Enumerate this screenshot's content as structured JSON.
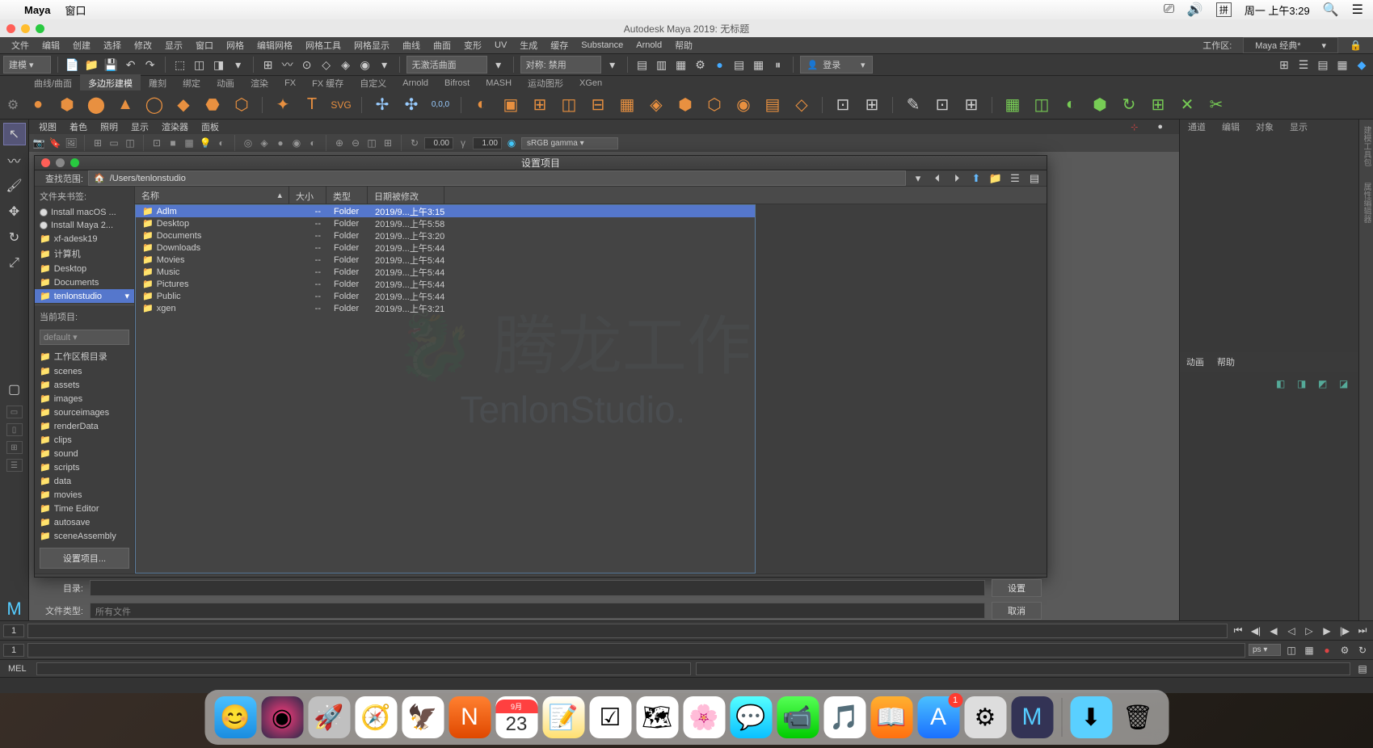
{
  "mac": {
    "app": "Maya",
    "menu": [
      "窗口"
    ],
    "tray": {
      "ime": "拼",
      "clock": "周一 上午3:29"
    }
  },
  "maya": {
    "title": "Autodesk Maya 2019: 无标题",
    "main_menu": [
      "文件",
      "编辑",
      "创建",
      "选择",
      "修改",
      "显示",
      "窗口",
      "网格",
      "编辑网格",
      "网格工具",
      "网格显示",
      "曲线",
      "曲面",
      "变形",
      "UV",
      "生成",
      "缓存",
      "Arnold",
      "帮助"
    ],
    "workspace_label": "工作区:",
    "workspace": "Maya 经典*",
    "mode": "建模",
    "curve_select": "无激活曲面",
    "sym_label": "对称: 禁用",
    "login": "登录",
    "shelf_tabs": [
      "曲线/曲面",
      "多边形建模",
      "雕刻",
      "绑定",
      "动画",
      "渲染",
      "FX",
      "FX 缓存",
      "自定义",
      "Arnold",
      "Bifrost",
      "MASH",
      "运动图形",
      "XGen"
    ],
    "active_shelf": 1,
    "panel_menu": [
      "视图",
      "着色",
      "照明",
      "显示",
      "渲染器",
      "面板"
    ],
    "panel_vals": {
      "v1": "0.00",
      "v2": "1.00",
      "colorspace": "sRGB gamma"
    },
    "right_tabs": [
      "通道",
      "编辑",
      "对象",
      "显示"
    ],
    "anim_tabs": [
      "动画",
      "帮助"
    ],
    "time": {
      "start": "1",
      "start2": "1",
      "fps": "ps"
    },
    "mel": "MEL",
    "sub_tab": "Substance"
  },
  "dialog": {
    "title": "设置项目",
    "search_label": "查找范围:",
    "path": "/Users/tenlonstudio",
    "bookmarks_label": "文件夹书签:",
    "bookmarks": [
      {
        "t": "disk",
        "label": "Install macOS ..."
      },
      {
        "t": "disk",
        "label": "Install Maya 2..."
      },
      {
        "t": "fold",
        "label": "xf-adesk19"
      },
      {
        "t": "fold",
        "label": "计算机"
      },
      {
        "t": "fold",
        "label": "Desktop"
      },
      {
        "t": "fold",
        "label": "Documents"
      },
      {
        "t": "fold",
        "label": "tenlonstudio",
        "sel": true
      }
    ],
    "current_label": "当前项目:",
    "current_sel": "default",
    "proj_dirs": [
      "工作区根目录",
      "scenes",
      "assets",
      "images",
      "sourceimages",
      "renderData",
      "clips",
      "sound",
      "scripts",
      "data",
      "movies",
      "Time Editor",
      "autosave",
      "sceneAssembly"
    ],
    "set_btn": "设置项目...",
    "cols": {
      "name": "名称",
      "size": "大小",
      "type": "类型",
      "date": "日期被修改"
    },
    "files": [
      {
        "name": "Adlm",
        "size": "--",
        "type": "Folder",
        "date": "2019/9...上午3:15",
        "sel": true
      },
      {
        "name": "Desktop",
        "size": "--",
        "type": "Folder",
        "date": "2019/9...上午5:58"
      },
      {
        "name": "Documents",
        "size": "--",
        "type": "Folder",
        "date": "2019/9...上午3:20"
      },
      {
        "name": "Downloads",
        "size": "--",
        "type": "Folder",
        "date": "2019/9...上午5:44"
      },
      {
        "name": "Movies",
        "size": "--",
        "type": "Folder",
        "date": "2019/9...上午5:44"
      },
      {
        "name": "Music",
        "size": "--",
        "type": "Folder",
        "date": "2019/9...上午5:44"
      },
      {
        "name": "Pictures",
        "size": "--",
        "type": "Folder",
        "date": "2019/9...上午5:44"
      },
      {
        "name": "Public",
        "size": "--",
        "type": "Folder",
        "date": "2019/9...上午5:44"
      },
      {
        "name": "xgen",
        "size": "--",
        "type": "Folder",
        "date": "2019/9...上午3:21"
      }
    ],
    "dir_label": "目录:",
    "type_label": "文件类型:",
    "type_placeholder": "所有文件",
    "ok": "设置",
    "cancel": "取消"
  },
  "dock": {
    "cal_month": "9月",
    "cal_day": "23",
    "appstore_badge": "1"
  },
  "watermark": {
    "line1": "腾龙工作",
    "line2": "TenlonStudio."
  }
}
